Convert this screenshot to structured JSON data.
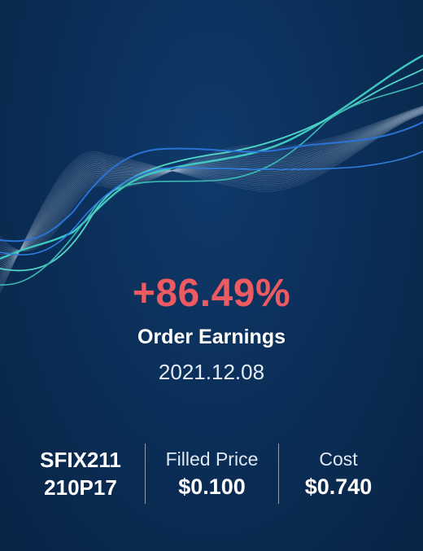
{
  "theme": {
    "accent_red": "#ee5a61",
    "text": "#ffffff",
    "background": "#0b2f59",
    "wave_teal": "#3fc8c0",
    "wave_blue": "#2a73d6",
    "wave_gray": "#9fb3c8"
  },
  "headline": {
    "percent": "+86.49%",
    "label": "Order Earnings",
    "date": "2021.12.08"
  },
  "stats": {
    "symbol_line1": "SFIX211",
    "symbol_line2": "210P17",
    "filled_price_label": "Filled Price",
    "filled_price_value": "$0.100",
    "cost_label": "Cost",
    "cost_value": "$0.740"
  }
}
